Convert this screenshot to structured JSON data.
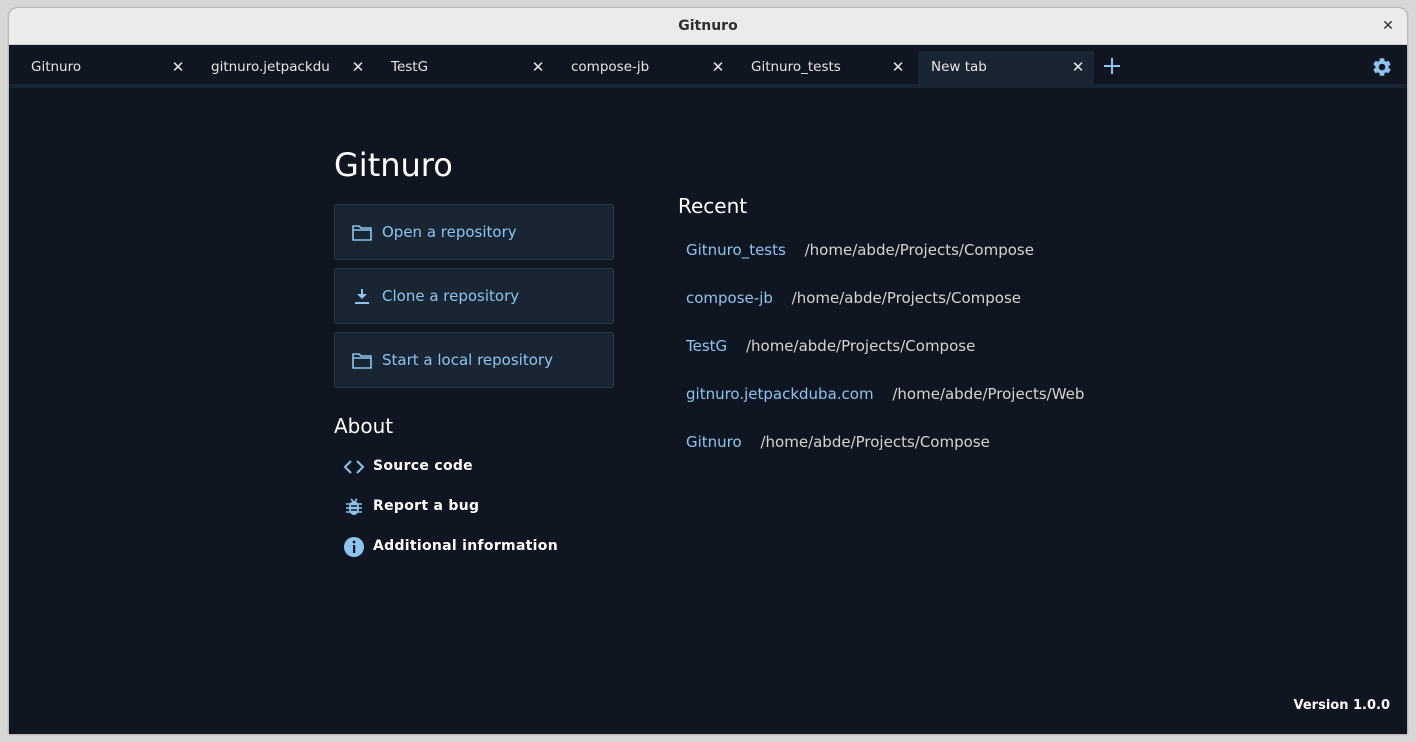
{
  "window": {
    "title": "Gitnuro",
    "close_glyph": "✕"
  },
  "tabs": [
    {
      "label": "Gitnuro",
      "active": false
    },
    {
      "label": "gitnuro.jetpackdu",
      "active": false
    },
    {
      "label": "TestG",
      "active": false
    },
    {
      "label": "compose-jb",
      "active": false
    },
    {
      "label": "Gitnuro_tests",
      "active": false
    },
    {
      "label": "New tab",
      "active": true
    }
  ],
  "tab_close_glyph": "✕",
  "icons": {
    "add_tab": "plus-icon",
    "settings": "gear-icon",
    "open": "folder-icon",
    "clone": "download-icon",
    "start": "folder-icon",
    "source": "code-icon",
    "bug": "bug-icon",
    "info": "info-icon"
  },
  "main": {
    "title": "Gitnuro",
    "actions": [
      {
        "label": "Open a repository"
      },
      {
        "label": "Clone a repository"
      },
      {
        "label": "Start a local repository"
      }
    ],
    "about": {
      "title": "About",
      "items": [
        {
          "label": "Source code"
        },
        {
          "label": "Report a bug"
        },
        {
          "label": "Additional information"
        }
      ]
    },
    "recent": {
      "title": "Recent",
      "items": [
        {
          "name": "Gitnuro_tests",
          "path": "/home/abde/Projects/Compose"
        },
        {
          "name": "compose-jb",
          "path": "/home/abde/Projects/Compose"
        },
        {
          "name": "TestG",
          "path": "/home/abde/Projects/Compose"
        },
        {
          "name": "gitnuro.jetpackduba.com",
          "path": "/home/abde/Projects/Web"
        },
        {
          "name": "Gitnuro",
          "path": "/home/abde/Projects/Compose"
        }
      ]
    },
    "version": "Version 1.0.0"
  },
  "colors": {
    "background": "#0f1621",
    "surface": "#1a2533",
    "accent": "#8cc4ee",
    "text": "#ffffff"
  }
}
